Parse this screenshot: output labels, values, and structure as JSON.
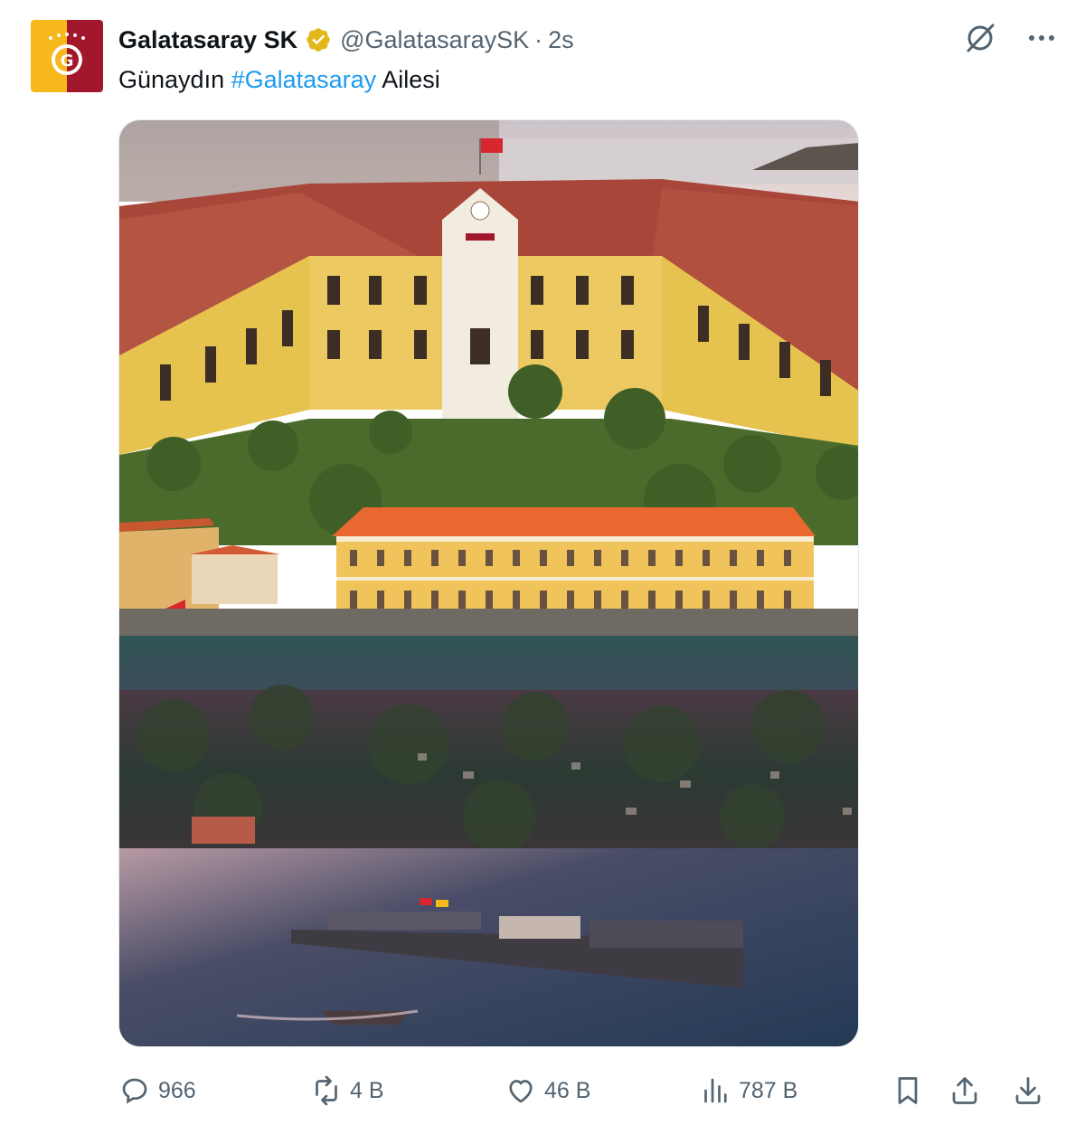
{
  "post": {
    "author": {
      "display_name": "Galatasaray SK",
      "handle": "@GalatasaraySK",
      "separator": "·",
      "time": "2s",
      "verified": true,
      "avatar_colors": {
        "left": "#f6b81c",
        "right": "#a3172d"
      }
    },
    "text": {
      "before": "Günaydın ",
      "hashtag": "#Galatasaray",
      "after": " Ailesi"
    },
    "media_icons": [
      "grok-icon",
      "more-icon"
    ],
    "actions": {
      "replies": "966",
      "reposts": "4 B",
      "likes": "46 B",
      "views": "787 B"
    }
  },
  "colors": {
    "text_primary": "#0f1419",
    "text_secondary": "#536471",
    "link": "#1d9bf0",
    "verified_gold": "#e2b719"
  }
}
